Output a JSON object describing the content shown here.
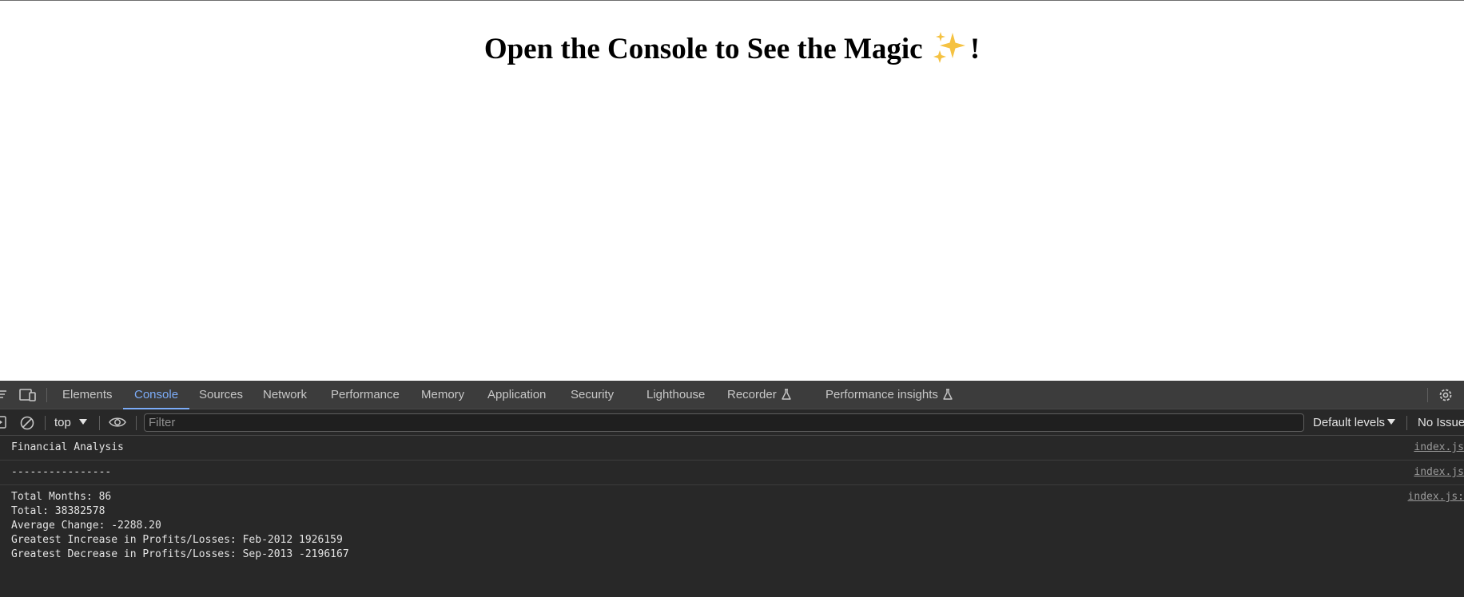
{
  "page": {
    "title_before": "Open the Console to See the Magic",
    "title_after": "!",
    "title_icon": "sparkles-icon"
  },
  "devtools": {
    "tabs": [
      {
        "label": "Elements"
      },
      {
        "label": "Console"
      },
      {
        "label": "Sources"
      },
      {
        "label": "Network"
      },
      {
        "label": "Performance"
      },
      {
        "label": "Memory"
      },
      {
        "label": "Application"
      },
      {
        "label": "Security"
      },
      {
        "label": "Lighthouse"
      },
      {
        "label": "Recorder"
      },
      {
        "label": "Performance insights"
      }
    ],
    "active_tab": "Console",
    "toolbar": {
      "context": "top",
      "filter_placeholder": "Filter",
      "filter_value": "",
      "levels": "Default levels",
      "issues": "No Issues"
    },
    "console": {
      "messages": [
        {
          "text": "Financial Analysis",
          "source": "index.js"
        },
        {
          "text": "----------------",
          "source": "index.js"
        },
        {
          "lines": [
            "Total Months: 86",
            "Total: 38382578",
            "Average Change: -2288.20",
            "Greatest Increase in Profits/Losses: Feb-2012 1926159",
            "Greatest Decrease in Profits/Losses: Sep-2013 -2196167"
          ],
          "source": "index.js:"
        }
      ]
    }
  },
  "colors": {
    "devtools_bg": "#282828",
    "tabbar_bg": "#3c3c3c",
    "accent": "#7cacf8",
    "sparkle": "#f5c242"
  }
}
